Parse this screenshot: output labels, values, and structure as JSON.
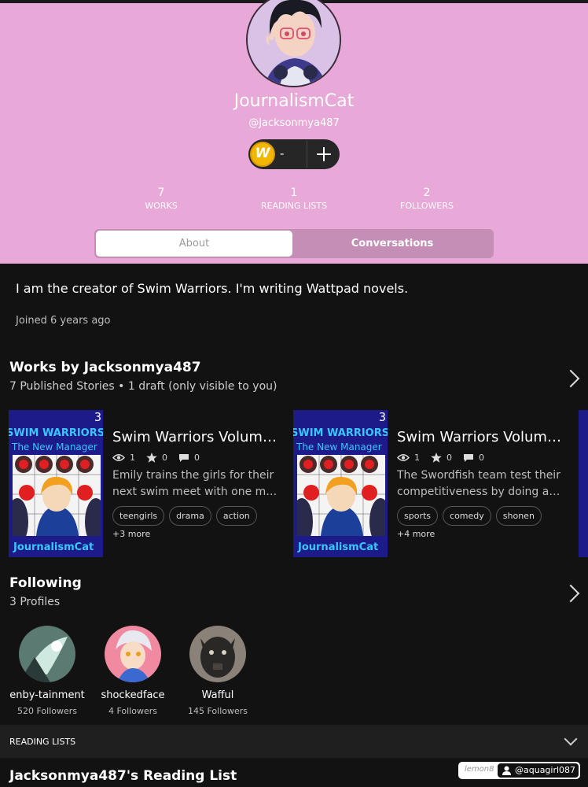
{
  "profile": {
    "display_name": "JournalismCat",
    "handle": "@Jacksonmya487",
    "coin_count": "-"
  },
  "stats": [
    {
      "value": "7",
      "label": "WORKS"
    },
    {
      "value": "1",
      "label": "READING LISTS"
    },
    {
      "value": "2",
      "label": "FOLLOWERS"
    }
  ],
  "tabs": {
    "about": "About",
    "conversations": "Conversations"
  },
  "about": {
    "bio": "I am the creator of Swim Warriors. I'm writing Wattpad novels.",
    "joined": "Joined 6 years ago"
  },
  "works": {
    "title": "Works by Jacksonmya487",
    "subtitle": "7 Published Stories • 1 draft (only visible to you)",
    "stories": [
      {
        "cover_volume": "3",
        "cover_title": "SWIM WARRIORS",
        "cover_subtitle": "The New Manager",
        "cover_author": "JournalismCat",
        "title": "Swim Warriors Volum…",
        "reads": "1",
        "votes": "0",
        "comments": "0",
        "desc_line1": "Emily trains the girls for their",
        "desc_line2": "next swim meet with one m…",
        "tags": [
          "teengirls",
          "drama",
          "action"
        ],
        "more": "+3 more"
      },
      {
        "cover_volume": "3",
        "cover_title": "SWIM WARRIORS",
        "cover_subtitle": "The New Manager",
        "cover_author": "JournalismCat",
        "title": "Swim Warriors Volum…",
        "reads": "1",
        "votes": "0",
        "comments": "0",
        "desc_line1": "The Swordfish team test their",
        "desc_line2": "competitiveness by doing a…",
        "tags": [
          "sports",
          "comedy",
          "shonen"
        ],
        "more": "+4 more"
      }
    ]
  },
  "following": {
    "title": "Following",
    "subtitle": "3 Profiles",
    "profiles": [
      {
        "name": "enby-tainment",
        "followers": "520 Followers"
      },
      {
        "name": "shockedface",
        "followers": "4 Followers"
      },
      {
        "name": "Wafful",
        "followers": "145 Followers"
      }
    ]
  },
  "reading_lists": {
    "bar_label": "READING LISTS",
    "list_title": "Jacksonmya487's Reading List"
  },
  "watermark": {
    "brand": "lemon8",
    "user": "@aquagirl087"
  },
  "colors": {
    "header_bg": "#e8a8d8",
    "segment_bg": "#c58eb7",
    "coin": "#f2b705",
    "cover_bg": "#1d1a8a",
    "cover_text": "#38c8ff"
  }
}
